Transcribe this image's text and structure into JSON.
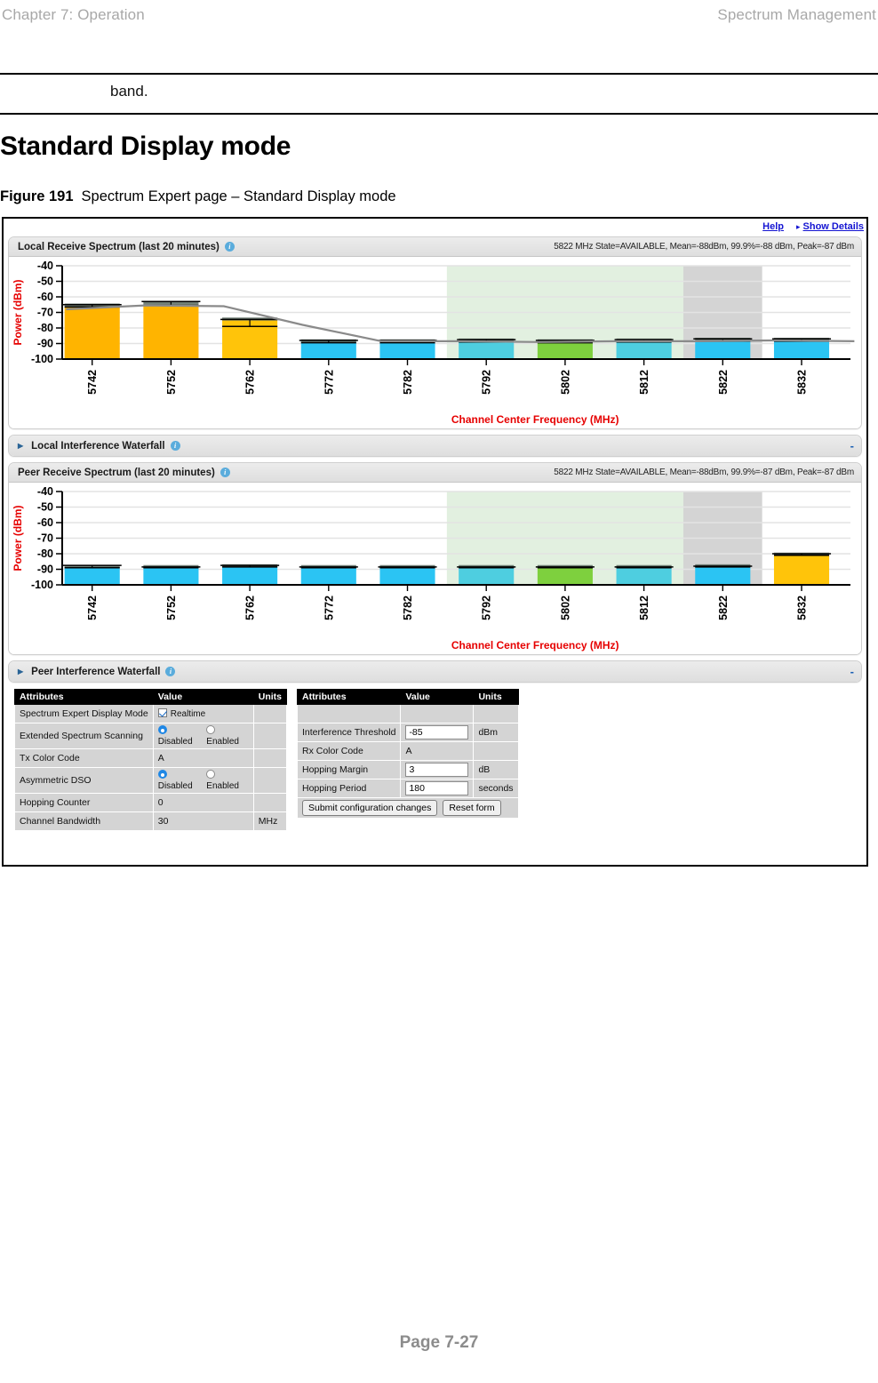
{
  "runhead": {
    "left": "Chapter 7:  Operation",
    "right": "Spectrum Management"
  },
  "note": {
    "text": "band."
  },
  "heading": "Standard Display mode",
  "figure": {
    "number": "Figure 191",
    "caption": "Spectrum Expert page – Standard Display mode"
  },
  "footer": {
    "page": "Page 7-27"
  },
  "screenshot": {
    "linkbar": {
      "help": "Help",
      "show_details": "Show Details",
      "arrow": "▸"
    },
    "panels": {
      "local_spectrum": {
        "title": "Local Receive Spectrum (last 20 minutes)",
        "stats": "5822 MHz State=AVAILABLE, Mean=-88dBm, 99.9%=-88 dBm, Peak=-87 dBm"
      },
      "local_waterfall": {
        "title": "Local Interference Waterfall",
        "minimize": "-"
      },
      "peer_spectrum": {
        "title": "Peer Receive Spectrum (last 20 minutes)",
        "stats": "5822 MHz State=AVAILABLE, Mean=-88dBm, 99.9%=-87 dBm, Peak=-87 dBm"
      },
      "peer_waterfall": {
        "title": "Peer Interference Waterfall",
        "minimize": "-"
      }
    },
    "tables": {
      "left": {
        "headers": [
          "Attributes",
          "Value",
          "Units"
        ],
        "rows": [
          {
            "label": "Spectrum Expert Display Mode",
            "value": "Realtime",
            "units": "",
            "type": "checkbox",
            "checked": true
          },
          {
            "label": "Extended Spectrum Scanning",
            "value": "Disabled",
            "units": "",
            "type": "radio",
            "options": [
              "Disabled",
              "Enabled"
            ]
          },
          {
            "label": "Tx Color Code",
            "value": "A",
            "units": "",
            "type": "text"
          },
          {
            "label": "Asymmetric DSO",
            "value": "Disabled",
            "units": "",
            "type": "radio",
            "options": [
              "Disabled",
              "Enabled"
            ]
          },
          {
            "label": "Hopping Counter",
            "value": "0",
            "units": "",
            "type": "text"
          },
          {
            "label": "Channel Bandwidth",
            "value": "30",
            "units": "MHz",
            "type": "text"
          }
        ]
      },
      "right": {
        "headers": [
          "Attributes",
          "Value",
          "Units"
        ],
        "rows": [
          {
            "label": "Interference Threshold",
            "value": "-85",
            "units": "dBm",
            "type": "input"
          },
          {
            "label": "Rx Color Code",
            "value": "A",
            "units": "",
            "type": "text"
          },
          {
            "label": "Hopping Margin",
            "value": "3",
            "units": "dB",
            "type": "input"
          },
          {
            "label": "Hopping Period",
            "value": "180",
            "units": "seconds",
            "type": "input"
          }
        ],
        "buttons": {
          "submit": "Submit configuration changes",
          "reset": "Reset form"
        }
      }
    }
  },
  "colors": {
    "orange": "#FFB400",
    "orange_dark": "#FFC40A",
    "cyan_bright": "#2BC4F3",
    "teal": "#4ECEE0",
    "green": "#7ED03E",
    "band_green": "#E2F0E0",
    "band_gray": "#D4D4D4",
    "axis_red": "#E60000",
    "link_blue": "#1414D2"
  },
  "chart_data": [
    {
      "type": "bar",
      "name": "local_receive_spectrum",
      "title": "Local Receive Spectrum (last 20 minutes)",
      "xlabel": "Channel Center Frequency (MHz)",
      "ylabel": "Power (dBm)",
      "ylim": [
        -100,
        -40
      ],
      "yticks": [
        -40,
        -50,
        -60,
        -70,
        -80,
        -90,
        -100
      ],
      "grid": true,
      "categories": [
        "5742",
        "5752",
        "5762",
        "5772",
        "5782",
        "5792",
        "5802",
        "5812",
        "5822",
        "5832"
      ],
      "values": [
        -66,
        -65,
        -75,
        -89,
        -89,
        -88.5,
        -89,
        -88.5,
        -88,
        -88
      ],
      "peaks": [
        -65,
        -63,
        -74.5,
        -88,
        -88,
        -87.5,
        -88,
        -87.5,
        -87,
        -87
      ],
      "minima": [
        -66.5,
        -65.5,
        -79,
        -89.5,
        -89.5,
        -89,
        -89.5,
        -89,
        -88.5,
        -88.5
      ],
      "bar_colors": [
        "#FFB400",
        "#FFB400",
        "#FFC40A",
        "#2BC4F3",
        "#2BC4F3",
        "#4ECEE0",
        "#7ED03E",
        "#4ECEE0",
        "#2BC4F3",
        "#2BC4F3"
      ],
      "trend_line": [
        -68,
        -65.5,
        -66,
        -78,
        -88.5,
        -88.5,
        -89,
        -88.5,
        -88.5,
        -88,
        -88.5
      ],
      "shaded_regions": [
        {
          "from": "5792",
          "to": "5812",
          "color": "#E2F0E0",
          "label": "available-band"
        },
        {
          "from": "5822",
          "to": "5822",
          "color": "#D4D4D4",
          "label": "operating-channel"
        }
      ]
    },
    {
      "type": "bar",
      "name": "peer_receive_spectrum",
      "title": "Peer Receive Spectrum (last 20 minutes)",
      "xlabel": "Channel Center Frequency (MHz)",
      "ylabel": "Power (dBm)",
      "ylim": [
        -100,
        -40
      ],
      "yticks": [
        -40,
        -50,
        -60,
        -70,
        -80,
        -90,
        -100
      ],
      "grid": true,
      "categories": [
        "5742",
        "5752",
        "5762",
        "5772",
        "5782",
        "5792",
        "5802",
        "5812",
        "5822",
        "5832"
      ],
      "values": [
        -89,
        -89,
        -88.5,
        -89,
        -89,
        -89,
        -89,
        -89,
        -88.5,
        -81
      ],
      "peaks": [
        -87.5,
        -88.5,
        -87.5,
        -88.5,
        -88.5,
        -88.5,
        -88.5,
        -88.5,
        -88,
        -80
      ],
      "minima": [
        -89,
        -89,
        -88.5,
        -89,
        -89,
        -89,
        -89,
        -89,
        -88.5,
        -81
      ],
      "bar_colors": [
        "#2BC4F3",
        "#2BC4F3",
        "#2BC4F3",
        "#2BC4F3",
        "#2BC4F3",
        "#4ECEE0",
        "#7ED03E",
        "#4ECEE0",
        "#2BC4F3",
        "#FFC40A"
      ],
      "trend_line": null,
      "shaded_regions": [
        {
          "from": "5792",
          "to": "5812",
          "color": "#E2F0E0",
          "label": "available-band"
        },
        {
          "from": "5822",
          "to": "5822",
          "color": "#D4D4D4",
          "label": "operating-channel"
        }
      ]
    }
  ]
}
